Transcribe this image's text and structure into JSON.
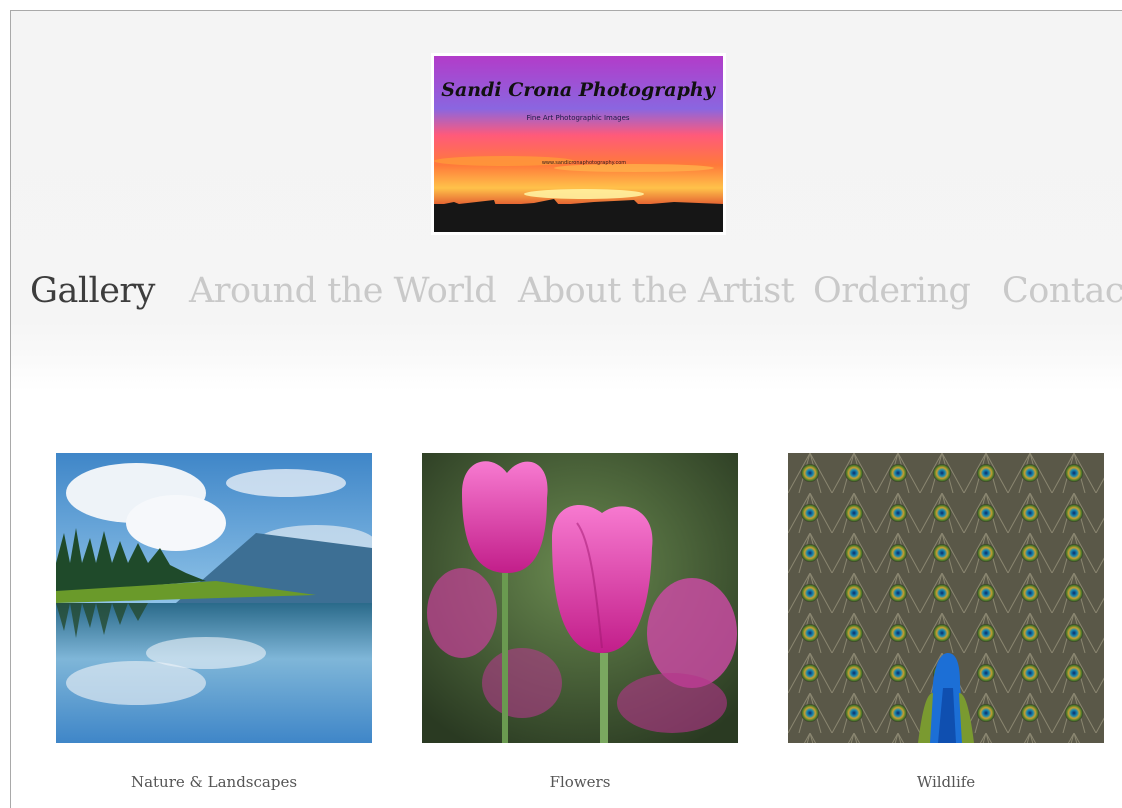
{
  "logo": {
    "title": "Sandi Crona Photography",
    "tagline": "Fine Art Photographic Images",
    "small_text": "www.sandicronaphotography.com"
  },
  "nav": {
    "items": [
      {
        "label": "Gallery",
        "active": true
      },
      {
        "label": "Around the World",
        "active": false
      },
      {
        "label": "About the Artist",
        "active": false
      },
      {
        "label": "Ordering",
        "active": false
      },
      {
        "label": "Contact",
        "active": false
      }
    ]
  },
  "gallery": {
    "items": [
      {
        "caption": "Nature & Landscapes",
        "image": "mountain-lake-landscape"
      },
      {
        "caption": "Flowers",
        "image": "pink-tulips"
      },
      {
        "caption": "Wildlife",
        "image": "peacock"
      }
    ]
  },
  "colors": {
    "nav_active": "#3d3d3d",
    "nav_inactive": "#c9c9c9",
    "header_bg": "#f4f4f4"
  }
}
